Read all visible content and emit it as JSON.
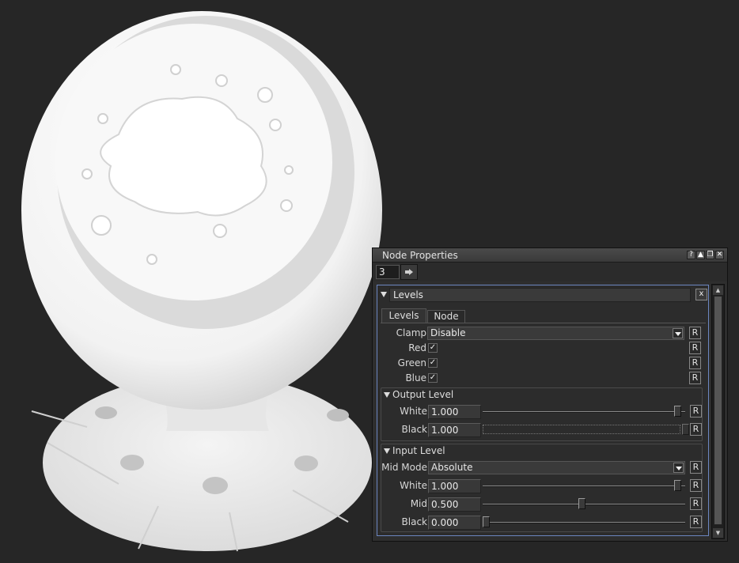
{
  "panel": {
    "title": "Node Properties",
    "titlebar_buttons": [
      "?",
      "▲",
      "❐",
      "✕"
    ],
    "view_number": "3",
    "lock_button_icon": "pin-icon"
  },
  "node": {
    "name": "Levels",
    "close_label": "x",
    "tabs": [
      {
        "label": "Levels",
        "active": true
      },
      {
        "label": "Node",
        "active": false
      }
    ]
  },
  "reset_label": "R",
  "levels": {
    "clamp": {
      "label": "Clamp",
      "value": "Disable"
    },
    "red": {
      "label": "Red",
      "checked": true
    },
    "green": {
      "label": "Green",
      "checked": true
    },
    "blue": {
      "label": "Blue",
      "checked": true
    },
    "check_mark": "✓"
  },
  "output_level": {
    "title": "Output Level",
    "white": {
      "label": "White",
      "value": "1.000",
      "level": 1.0
    },
    "black": {
      "label": "Black",
      "value": "1.000"
    }
  },
  "input_level": {
    "title": "Input Level",
    "mid_mode": {
      "label": "Mid Mode",
      "value": "Absolute"
    },
    "white": {
      "label": "White",
      "value": "1.000",
      "level": 1.0
    },
    "mid": {
      "label": "Mid",
      "value": "0.500",
      "level": 0.5
    },
    "black": {
      "label": "Black",
      "value": "0.000",
      "level": 0.0
    }
  },
  "colors": {
    "background": "#262626",
    "panel": "#2e2e2e",
    "selection_border": "#6c86c0"
  }
}
